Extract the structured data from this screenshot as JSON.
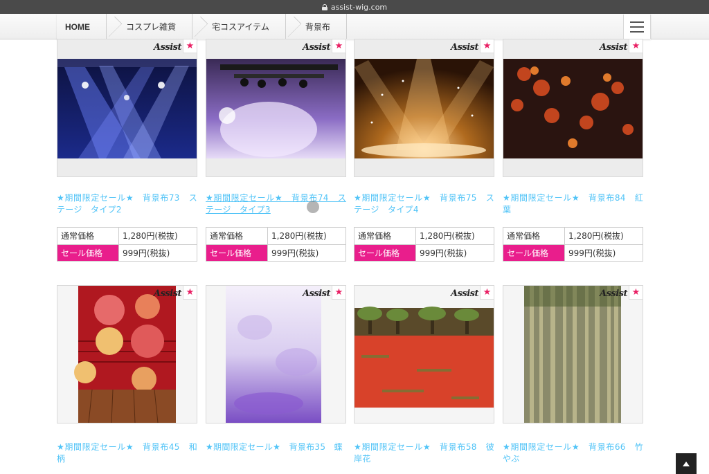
{
  "browser": {
    "url": "assist-wig.com"
  },
  "breadcrumb": [
    "HOME",
    "コスプレ雑貨",
    "宅コスアイテム",
    "背景布"
  ],
  "brand_logo_text": "Assist",
  "price_labels": {
    "regular": "通常価格",
    "sale": "セール価格"
  },
  "products": [
    {
      "title": "★期間限定セール★　背景布73　ステージ　タイプ2",
      "regular_price": "1,280円(税抜)",
      "sale_price": "999円(税抜)",
      "image": "blue-stage-lights"
    },
    {
      "title": "★期間限定セール★　背景布74　ステージ　タイプ3",
      "regular_price": "1,280円(税抜)",
      "sale_price": "999円(税抜)",
      "image": "purple-stage-lights"
    },
    {
      "title": "★期間限定セール★　背景布75　ステージ　タイプ4",
      "regular_price": "1,280円(税抜)",
      "sale_price": "999円(税抜)",
      "image": "golden-sparkle-stage"
    },
    {
      "title": "★期間限定セール★　背景布84　紅葉",
      "regular_price": "1,280円(税抜)",
      "sale_price": "999円(税抜)",
      "image": "red-maple-leaves"
    },
    {
      "title": "★期間限定セール★　背景布45　和柄",
      "image": "japanese-umbrellas"
    },
    {
      "title": "★期間限定セール★　背景布35　蝶",
      "image": "purple-watercolor"
    },
    {
      "title": "★期間限定セール★　背景布58　彼岸花",
      "image": "red-spider-lily-field"
    },
    {
      "title": "★期間限定セール★　背景布66　竹やぶ",
      "image": "bamboo-grove"
    }
  ],
  "colors": {
    "title_link": "#4fc3f7",
    "sale_label_bg": "#e91e8c",
    "star": "#e91e63"
  },
  "icons": {
    "badge": "star-icon",
    "menu": "hamburger-icon",
    "back_to_top": "triangle-up-icon",
    "secure": "lock-icon"
  }
}
